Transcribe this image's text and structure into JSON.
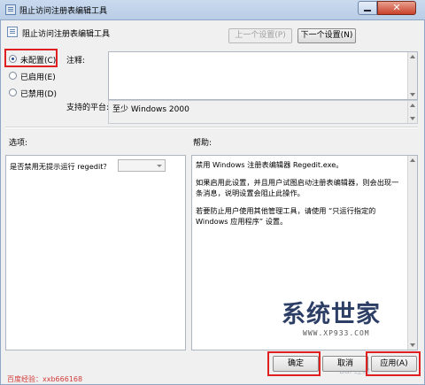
{
  "window": {
    "title": "阻止访问注册表编辑工具",
    "close_glyph": "✕"
  },
  "policy": {
    "name": "阻止访问注册表编辑工具",
    "prev_setting": "上一个设置(P)",
    "next_setting": "下一个设置(N)"
  },
  "state": {
    "options": [
      {
        "label": "未配置(C)",
        "checked": true
      },
      {
        "label": "已启用(E)",
        "checked": false
      },
      {
        "label": "已禁用(D)",
        "checked": false
      }
    ]
  },
  "comment": {
    "label": "注释:",
    "value": ""
  },
  "platform": {
    "label": "支持的平台:",
    "value": "至少 Windows 2000"
  },
  "options_section": {
    "label": "选项:",
    "question": "是否禁用无提示运行 regedit？",
    "dropdown_value": ""
  },
  "help_section": {
    "label": "帮助:",
    "paragraphs": [
      "禁用 Windows 注册表编辑器 Regedit.exe。",
      "如果启用此设置，并且用户试图启动注册表编辑器，则会出现一条消息，说明设置会阻止此操作。",
      "若要防止用户使用其他管理工具，请使用 “只运行指定的 Windows 应用程序” 设置。"
    ]
  },
  "buttons": {
    "ok": "确定",
    "cancel": "取消",
    "apply": "应用(A)"
  },
  "watermark": {
    "logo_part1": "系统",
    "logo_part2": "世家",
    "url": "WWW.XP933.COM",
    "baidu": "Bai 经验"
  },
  "footer_note": "百度经验：xxb666168",
  "colors": {
    "highlight_box": "#e02020",
    "title_bar": "#c9daee",
    "close_button": "#c8412a"
  }
}
